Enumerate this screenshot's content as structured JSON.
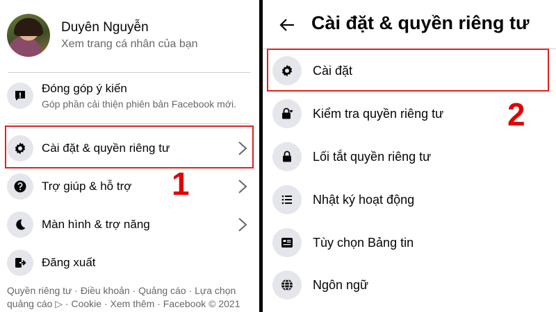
{
  "left": {
    "profile": {
      "name": "Duyên Nguyễn",
      "subtitle": "Xem trang cá nhân của bạn"
    },
    "feedback": {
      "title": "Đóng góp ý kiến",
      "subtitle": "Góp phần cải thiện phiên bản Facebook mới."
    },
    "menu": [
      {
        "label": "Cài đặt & quyền riêng tư",
        "icon": "gear-icon"
      },
      {
        "label": "Trợ giúp & hỗ trợ",
        "icon": "help-icon"
      },
      {
        "label": "Màn hình & trợ năng",
        "icon": "moon-icon"
      },
      {
        "label": "Đăng xuất",
        "icon": "logout-icon"
      }
    ],
    "footer_line1": "Quyền riêng tư · Điều khoản · Quảng cáo · Lựa chọn",
    "footer_line2a": "quảng cáo",
    "footer_line2b": " · Cookie · Xem thêm · Facebook © 2021"
  },
  "right": {
    "title": "Cài đặt & quyền riêng tư",
    "items": [
      {
        "label": "Cài đặt",
        "icon": "gear-icon"
      },
      {
        "label": "Kiểm tra quyền riêng tư",
        "icon": "lock-heart-icon"
      },
      {
        "label": "Lối tắt quyền riêng tư",
        "icon": "lock-icon"
      },
      {
        "label": "Nhật ký hoạt động",
        "icon": "list-icon"
      },
      {
        "label": "Tùy chọn Bảng tin",
        "icon": "news-feed-icon"
      },
      {
        "label": "Ngôn ngữ",
        "icon": "globe-icon"
      }
    ]
  },
  "steps": {
    "one": "1",
    "two": "2"
  },
  "colors": {
    "highlight": "#e02020",
    "step": "#e00000",
    "icon_bg": "#e4e6eb"
  }
}
